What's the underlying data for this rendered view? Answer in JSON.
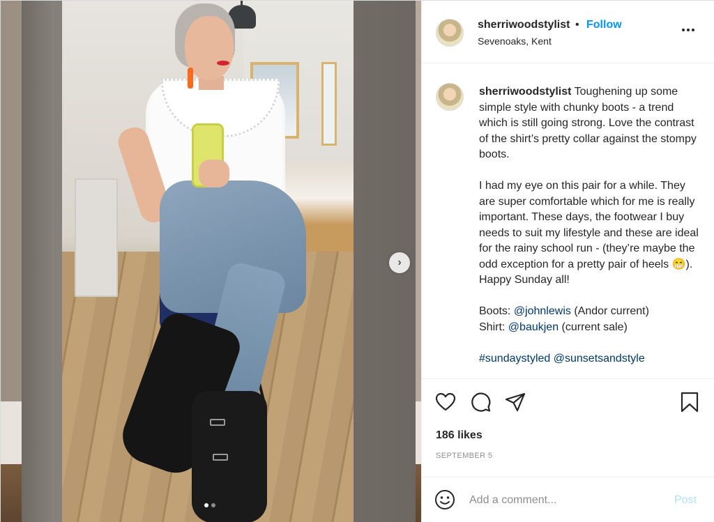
{
  "post": {
    "username": "sherriwoodstylist",
    "bullet": "•",
    "follow_label": "Follow",
    "location": "Sevenoaks, Kent",
    "caption_user": "sherriwoodstylist",
    "caption_text": " Toughening up some simple style with chunky boots - a trend which is still going strong. Love the contrast of the shirt’s pretty collar against the stompy boots.\n\nI had my eye on this pair for a while. They are super comfortable which for me is really important. These days, the footwear I buy needs to suit my lifestyle and these are ideal for the rainy school run - (they’re maybe the odd exception for a pretty pair of heels 😁). Happy Sunday all!\n\nBoots: ",
    "mention_1": "@johnlewis",
    "after_mention_1": " (Andor current)\nShirt: ",
    "mention_2": "@baukjen",
    "after_mention_2": " (current sale)\n\n",
    "hashtag": "#sundaystyled",
    "mention_3": "@sunsetsandstyle",
    "likes": "186 likes",
    "date": "SEPTEMBER 5"
  },
  "actions": {
    "like_icon": "heart-icon",
    "comment_icon": "comment-icon",
    "share_icon": "send-icon",
    "save_icon": "bookmark-icon"
  },
  "comment": {
    "placeholder": "Add a comment...",
    "post_label": "Post"
  },
  "carousel": {
    "next_glyph": "›",
    "count": 2,
    "active": 1
  },
  "colors": {
    "follow": "#0095f6",
    "link": "#00376b",
    "post_disabled": "#b2dffc",
    "muted": "#8e8e8e"
  }
}
